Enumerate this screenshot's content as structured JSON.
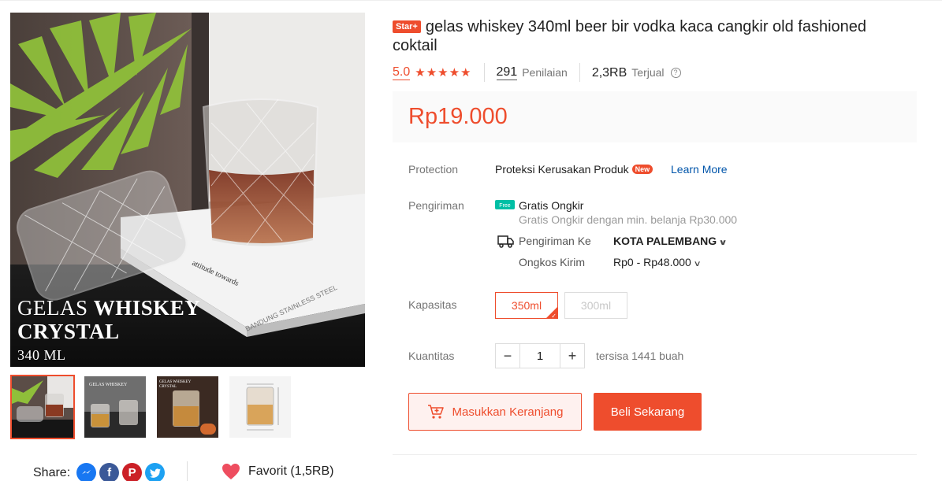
{
  "product": {
    "badge": "Star+",
    "title": "gelas whiskey 340ml beer bir vodka kaca cangkir old fashioned coktail",
    "rating": "5.0",
    "stars": "★★★★★",
    "rating_stars_value": 5,
    "reviews_count": "291",
    "reviews_label": "Penilaian",
    "sold_count": "2,3RB",
    "sold_label": "Terjual",
    "price": "Rp19.000"
  },
  "main_image": {
    "caption_line1": "GELAS",
    "caption_line1_bold": "WHISKEY",
    "caption_line2": "CRYSTAL",
    "caption_line3": "340 ML"
  },
  "protection": {
    "label": "Protection",
    "text": "Proteksi Kerusakan Produk",
    "badge": "New",
    "link": "Learn More"
  },
  "shipping": {
    "label": "Pengiriman",
    "free_badge": "Free",
    "title": "Gratis Ongkir",
    "subtitle": "Gratis Ongkir dengan min. belanja Rp30.000",
    "to_label": "Pengiriman Ke",
    "to_value": "KOTA PALEMBANG",
    "cost_label": "Ongkos Kirim",
    "cost_value": "Rp0 - Rp48.000"
  },
  "capacity": {
    "label": "Kapasitas",
    "options": [
      "350ml",
      "300ml"
    ],
    "selected": "350ml"
  },
  "quantity": {
    "label": "Kuantitas",
    "minus": "−",
    "value": "1",
    "plus": "+",
    "stock": "tersisa 1441 buah"
  },
  "actions": {
    "add_to_cart": "Masukkan Keranjang",
    "buy_now": "Beli Sekarang"
  },
  "share": {
    "label": "Share:",
    "icons": [
      "messenger-icon",
      "facebook-icon",
      "pinterest-icon",
      "twitter-icon"
    ]
  },
  "favorite": {
    "label": "Favorit (1,5RB)"
  },
  "colors": {
    "accent": "#ee4d2d",
    "link": "#0055aa",
    "free_badge": "#00bfa5",
    "messenger": "#1877f2",
    "facebook": "#3b5998",
    "pinterest": "#cb2027",
    "twitter": "#1da1f2"
  }
}
